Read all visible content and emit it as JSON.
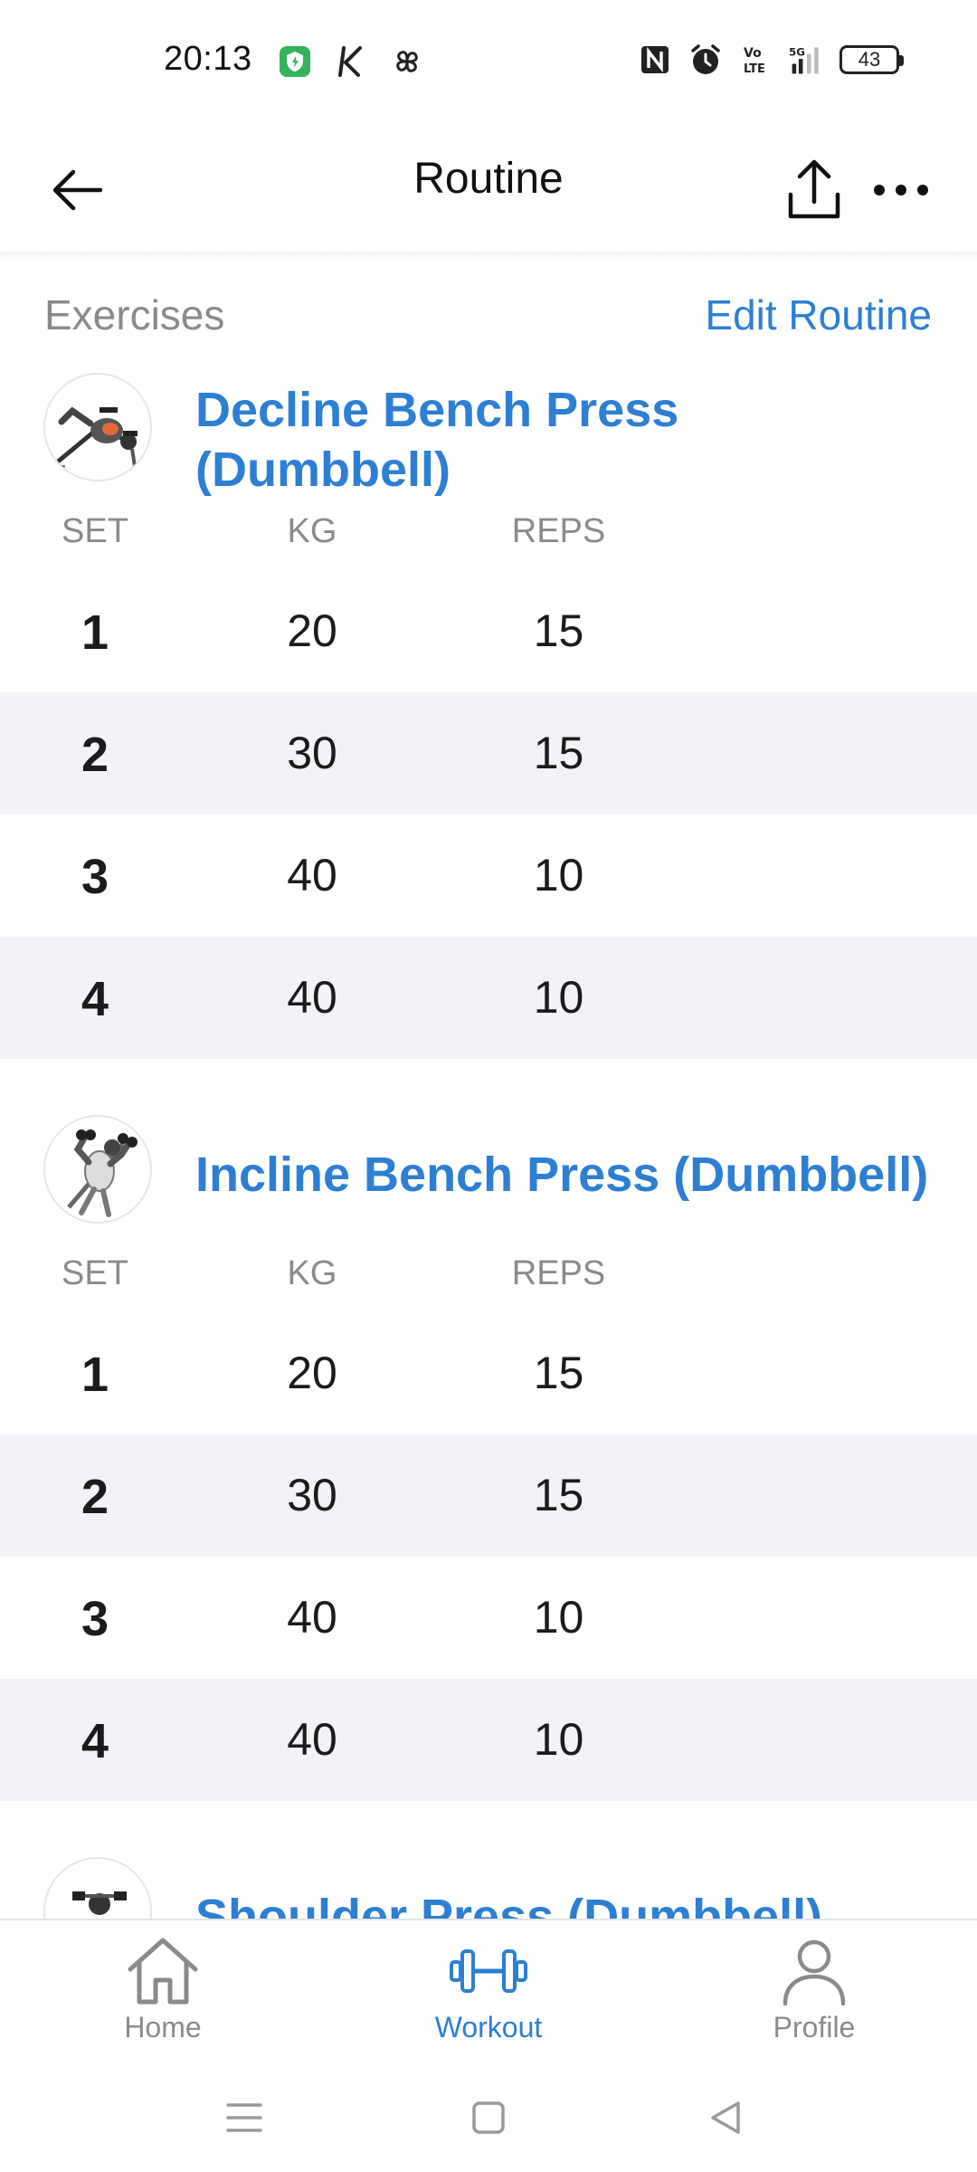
{
  "status_bar": {
    "time": "20:13",
    "battery": "43",
    "left_icons": [
      "shield-app-icon",
      "k-app-icon",
      "pinwheel-app-icon"
    ],
    "right_icons": [
      "nfc-icon",
      "alarm-icon",
      "volte-icon",
      "signal-5g-icon",
      "battery-icon"
    ]
  },
  "header": {
    "title": "Routine"
  },
  "section": {
    "label": "Exercises",
    "edit_label": "Edit Routine"
  },
  "columns": {
    "set": "SET",
    "kg": "KG",
    "reps": "REPS"
  },
  "exercises": [
    {
      "name_line1": "Decline Bench Press",
      "name_line2": "(Dumbbell)",
      "sets": [
        {
          "set": "1",
          "kg": "20",
          "reps": "15"
        },
        {
          "set": "2",
          "kg": "30",
          "reps": "15"
        },
        {
          "set": "3",
          "kg": "40",
          "reps": "10"
        },
        {
          "set": "4",
          "kg": "40",
          "reps": "10"
        }
      ]
    },
    {
      "name": "Incline Bench Press (Dumbbell)",
      "sets": [
        {
          "set": "1",
          "kg": "20",
          "reps": "15"
        },
        {
          "set": "2",
          "kg": "30",
          "reps": "15"
        },
        {
          "set": "3",
          "kg": "40",
          "reps": "10"
        },
        {
          "set": "4",
          "kg": "40",
          "reps": "10"
        }
      ]
    },
    {
      "name": "Shoulder Press (Dumbbell)"
    }
  ],
  "bottom_nav": {
    "items": [
      {
        "label": "Home",
        "icon": "home-icon",
        "active": false
      },
      {
        "label": "Workout",
        "icon": "dumbbell-icon",
        "active": true
      },
      {
        "label": "Profile",
        "icon": "profile-icon",
        "active": false
      }
    ]
  },
  "colors": {
    "accent": "#2d7fd3",
    "muted": "#8a8a8e",
    "row_alt": "#f2f3f6"
  }
}
